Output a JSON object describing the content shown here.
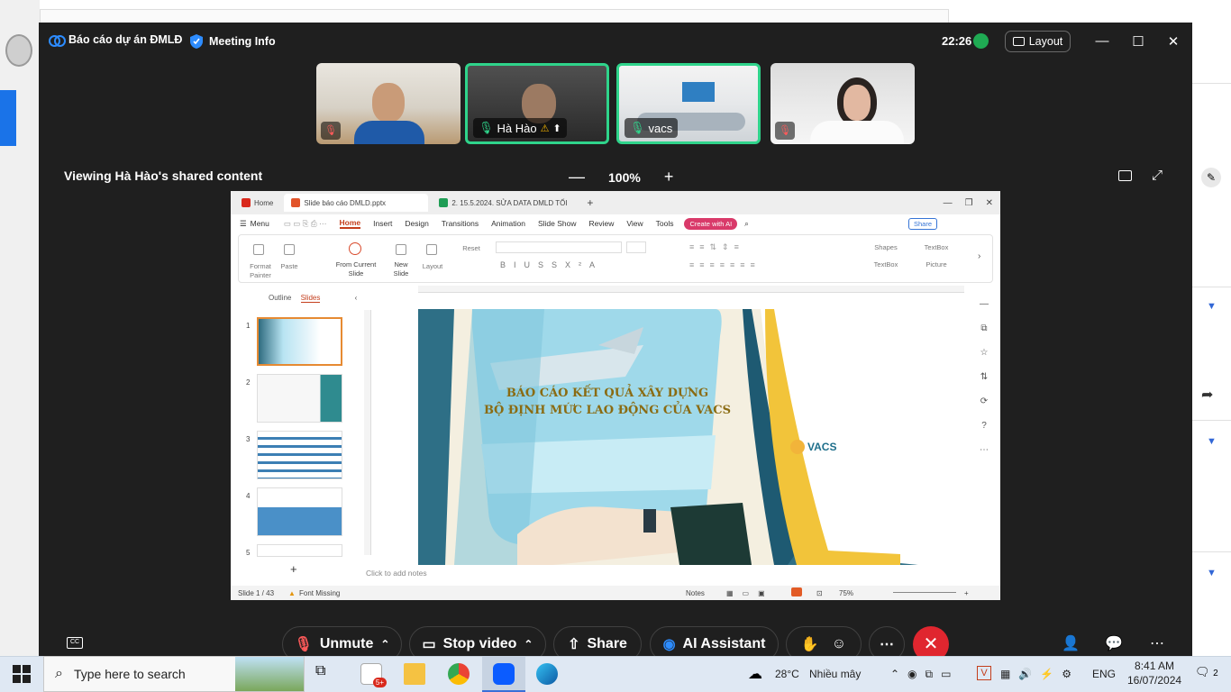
{
  "zoom": {
    "meeting_title": "Báo cáo dự án ĐMLĐ",
    "meeting_info_label": "Meeting Info",
    "clock": "22:26",
    "layout_label": "Layout",
    "participants": [
      {
        "name": "",
        "muted": true
      },
      {
        "name": "Hà Hào",
        "muted": false
      },
      {
        "name": "vacs",
        "muted": false
      },
      {
        "name": "",
        "muted": true
      }
    ],
    "viewing_label": "Viewing Hà Hào's shared content",
    "zoom_level": "100%",
    "controls": {
      "unmute": "Unmute",
      "stop_video": "Stop video",
      "share": "Share",
      "ai_assistant": "AI Assistant"
    }
  },
  "wps": {
    "tabs": [
      "Home",
      "Slide báo cáo DMLD.pptx",
      "2. 15.5.2024. SỬA DATA DMLD TỐI"
    ],
    "menu_label": "Menu",
    "menu_items": [
      "Home",
      "Insert",
      "Design",
      "Transitions",
      "Animation",
      "Slide Show",
      "Review",
      "View",
      "Tools"
    ],
    "create_ai": "Create with AI",
    "share_btn": "Share",
    "ribbon": {
      "format_painter": "Format Painter",
      "paste": "Paste",
      "from_current": "From Current Slide",
      "new_slide": "New Slide",
      "layout": "Layout",
      "reset": "Reset",
      "shapes": "Shapes",
      "textbox": "TextBox",
      "textbox2": "TextBox",
      "picture": "Picture"
    },
    "panel_tabs": [
      "Outline",
      "Slides"
    ],
    "slide_numbers": [
      "1",
      "2",
      "3",
      "4",
      "5"
    ],
    "slide_title_line1": "BÁO CÁO KẾT QUẢ XÂY DỰNG",
    "slide_title_line2": "BỘ ĐỊNH MỨC LAO ĐỘNG CỦA VACS",
    "brand": "VACS",
    "notes_placeholder": "Click to add notes",
    "status": {
      "slide_count": "Slide 1 / 43",
      "font_missing": "Font Missing",
      "notes": "Notes",
      "zoom": "75%"
    }
  },
  "taskbar": {
    "search_placeholder": "Type here to search",
    "weather_temp": "28°C",
    "weather_text": "Nhiều mây",
    "language": "ENG",
    "time": "8:41 AM",
    "date": "16/07/2024",
    "notifications": "2",
    "badge": "5+"
  },
  "colors": {
    "zoom_bg": "#1f1f1f",
    "active_speaker": "#2fd48b",
    "end_red": "#e0262f",
    "wps_accent": "#c43e1c",
    "slide_title": "#8a6b12"
  }
}
